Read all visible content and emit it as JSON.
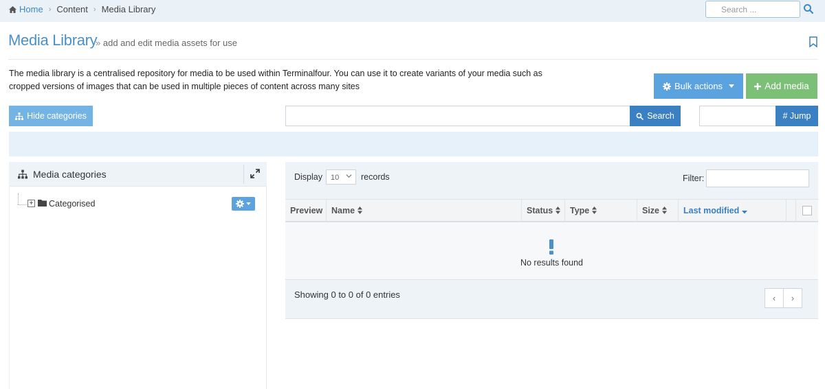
{
  "breadcrumb": {
    "home": "Home",
    "items": [
      "Content",
      "Media Library"
    ]
  },
  "topsearch": {
    "placeholder": "Search ..."
  },
  "page": {
    "title": "Media Library",
    "subtitle": "add and edit media assets for use",
    "description": "The media library is a centralised repository for media to be used within Terminalfour. You can use it to create variants of your media such as cropped versions of images that can be used in multiple pieces of content across many sites"
  },
  "actions": {
    "bulk": "Bulk actions",
    "add": "Add media",
    "hide_categories": "Hide categories",
    "search": "Search",
    "jump": "# Jump"
  },
  "categories": {
    "title": "Media categories",
    "tree": [
      {
        "label": "Categorised"
      }
    ]
  },
  "table": {
    "display_label": "Display",
    "display_value": "10",
    "records_label": "records",
    "filter_label": "Filter:",
    "columns": [
      "Preview",
      "Name",
      "Status",
      "Type",
      "Size",
      "Last modified"
    ],
    "empty_message": "No results found",
    "summary": "Showing 0 to 0 of 0 entries",
    "pager": {
      "prev": "‹",
      "next": "›"
    }
  },
  "colors": {
    "accent": "#3b80c2",
    "bulk": "#5aa3de",
    "add": "#7cc078",
    "title": "#4a90c9"
  }
}
